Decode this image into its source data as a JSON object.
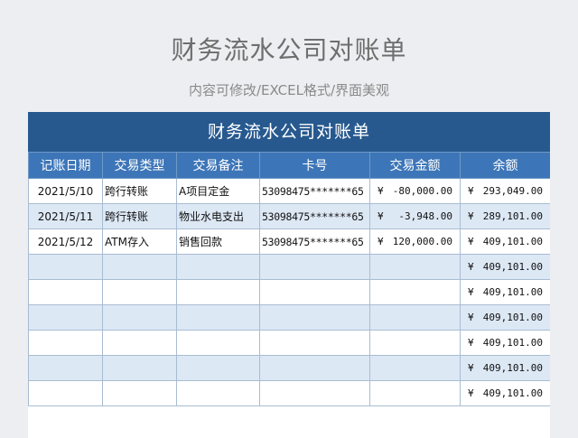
{
  "page": {
    "title": "财务流水公司对账单",
    "subtitle": "内容可修改/EXCEL格式/界面美观"
  },
  "sheet": {
    "banner": "财务流水公司对账单",
    "columns": [
      "记账日期",
      "交易类型",
      "交易备注",
      "卡号",
      "交易金额",
      "余额"
    ],
    "currency_symbol": "¥",
    "rows": [
      {
        "date": "2021/5/10",
        "type": "跨行转账",
        "note": "A项目定金",
        "card": "53098475*******65",
        "amount": "-80,000.00",
        "balance": "293,049.00"
      },
      {
        "date": "2021/5/11",
        "type": "跨行转账",
        "note": "物业水电支出",
        "card": "53098475*******65",
        "amount": "-3,948.00",
        "balance": "289,101.00"
      },
      {
        "date": "2021/5/12",
        "type": "ATM存入",
        "note": "销售回款",
        "card": "53098475*******65",
        "amount": "120,000.00",
        "balance": "409,101.00"
      },
      {
        "date": "",
        "type": "",
        "note": "",
        "card": "",
        "amount": "",
        "balance": "409,101.00"
      },
      {
        "date": "",
        "type": "",
        "note": "",
        "card": "",
        "amount": "",
        "balance": "409,101.00"
      },
      {
        "date": "",
        "type": "",
        "note": "",
        "card": "",
        "amount": "",
        "balance": "409,101.00"
      },
      {
        "date": "",
        "type": "",
        "note": "",
        "card": "",
        "amount": "",
        "balance": "409,101.00"
      },
      {
        "date": "",
        "type": "",
        "note": "",
        "card": "",
        "amount": "",
        "balance": "409,101.00"
      },
      {
        "date": "",
        "type": "",
        "note": "",
        "card": "",
        "amount": "",
        "balance": "409,101.00"
      }
    ]
  },
  "colors": {
    "banner_bg": "#27598f",
    "header_bg": "#3d76b8",
    "row_alt_bg": "#dde8f5",
    "page_bg": "#eceef1"
  }
}
